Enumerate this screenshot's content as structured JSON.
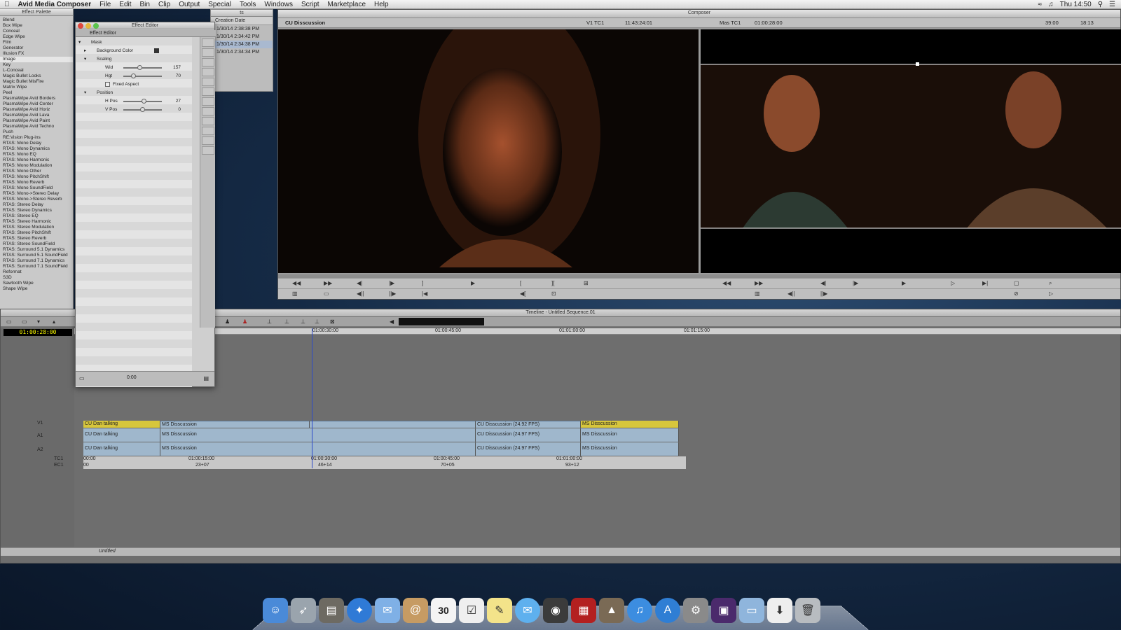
{
  "menubar": {
    "app": "Avid Media Composer",
    "items": [
      "File",
      "Edit",
      "Bin",
      "Clip",
      "Output",
      "Special",
      "Tools",
      "Windows",
      "Script",
      "Marketplace",
      "Help"
    ],
    "clock": "Thu 14:50"
  },
  "palette": {
    "title": "Effect Palette",
    "categories": [
      "Blend",
      "Box Wipe",
      "Conceal",
      "Edge Wipe",
      "Film",
      "Generator",
      "Illusion FX",
      "Image",
      "Key",
      "L-Conceal",
      "Magic Bullet Looks",
      "Magic Bullet MisFire",
      "Matrix Wipe",
      "Peel",
      "PlasmaWipe Avid Borders",
      "PlasmaWipe Avid Center",
      "PlasmaWipe Avid Horiz",
      "PlasmaWipe Avid Lava",
      "PlasmaWipe Avid Paint",
      "PlasmaWipe Avid Techno",
      "Push",
      "RE:Vision Plug-ins",
      "RTAS: Mono Delay",
      "RTAS: Mono Dynamics",
      "RTAS: Mono EQ",
      "RTAS: Mono Harmonic",
      "RTAS: Mono Modulation",
      "RTAS: Mono Other",
      "RTAS: Mono PitchShift",
      "RTAS: Mono Reverb",
      "RTAS: Mono SoundField",
      "RTAS: Mono->Stereo Delay",
      "RTAS: Mono->Stereo Reverb",
      "RTAS: Stereo Delay",
      "RTAS: Stereo Dynamics",
      "RTAS: Stereo EQ",
      "RTAS: Stereo Harmonic",
      "RTAS: Stereo Modulation",
      "RTAS: Stereo PitchShift",
      "RTAS: Stereo Reverb",
      "RTAS: Stereo SoundField",
      "RTAS: Surround 5.1 Dynamics",
      "RTAS: Surround 5.1 SoundField",
      "RTAS: Surround 7.1 Dynamics",
      "RTAS: Surround 7.1 SoundField",
      "Reformat",
      "S3D",
      "Sawtooth Wipe",
      "Shape Wipe"
    ],
    "selected_index": 7
  },
  "bin": {
    "column": "Creation Date",
    "rows": [
      "1/30/14 2:38:38 PM",
      "1/30/14 2:34:42 PM",
      "1/30/14 2:34:38 PM",
      "1/30/14 2:34:34 PM"
    ],
    "selected_index": 2,
    "partial_title": "ts"
  },
  "editor": {
    "window_title": "Effect Editor",
    "tab": "Effect Editor",
    "mask": "Mask",
    "background_color": "Background Color",
    "scaling": "Scaling",
    "wid_label": "Wid",
    "wid_value": "157",
    "wid_fraction": 0.42,
    "hgt_label": "Hgt",
    "hgt_value": "70",
    "hgt_fraction": 0.22,
    "fixed_aspect": "Fixed Aspect",
    "position": "Position",
    "hpos_label": "H Pos",
    "hpos_value": "27",
    "hpos_fraction": 0.55,
    "vpos_label": "V Pos",
    "vpos_value": "0",
    "vpos_fraction": 0.5,
    "time": "0:00"
  },
  "composer": {
    "title": "Composer",
    "clip": "CU Disscussion",
    "src_track": "V1 TC1",
    "src_tc": "11:43:24:01",
    "rec_track": "Mas TC1",
    "rec_tc": "01:00:28:00",
    "dur1": "39:00",
    "dur2": "18:13"
  },
  "timeline": {
    "title": "Timeline - Untitled Sequence.01",
    "timecode": "01:00:28:00",
    "ruler": [
      "01:00:30:00",
      "01:00:45:00",
      "01:01:00:00",
      "01:01:15:00"
    ],
    "tc_ruler": [
      "00:00",
      "01:00:15:00",
      "01:00:30:00",
      "01:00:45:00",
      "01:01:00:00"
    ],
    "ec_ruler": [
      "00",
      "23+07",
      "46+14",
      "70+05",
      "93+12"
    ],
    "tracks": {
      "v1": "V1",
      "a1": "A1",
      "a2": "A2",
      "tc1": "TC1",
      "ec1": "EC1"
    },
    "clips": {
      "c1": "CU Dan talking",
      "c2": "MS Disscussion",
      "c3": "CU Disscussion (24.92 FPS)",
      "c3a": "CU Disscussion (24.97 FPS)",
      "c4": "MS Disscussion"
    },
    "bottom_label": "Untitled"
  },
  "dock": {
    "icons": [
      "finder-icon",
      "launchpad-icon",
      "image-capture-icon",
      "safari-icon",
      "mail-icon",
      "contacts-icon",
      "calendar-icon",
      "reminders-icon",
      "notes-icon",
      "messages-icon",
      "facetime-icon",
      "photo-booth-icon",
      "iphoto-icon",
      "itunes-icon",
      "app-store-icon",
      "system-preferences-icon",
      "avid-icon",
      "documents-folder-icon",
      "downloads-icon",
      "trash-icon"
    ],
    "calendar_day": "30"
  }
}
